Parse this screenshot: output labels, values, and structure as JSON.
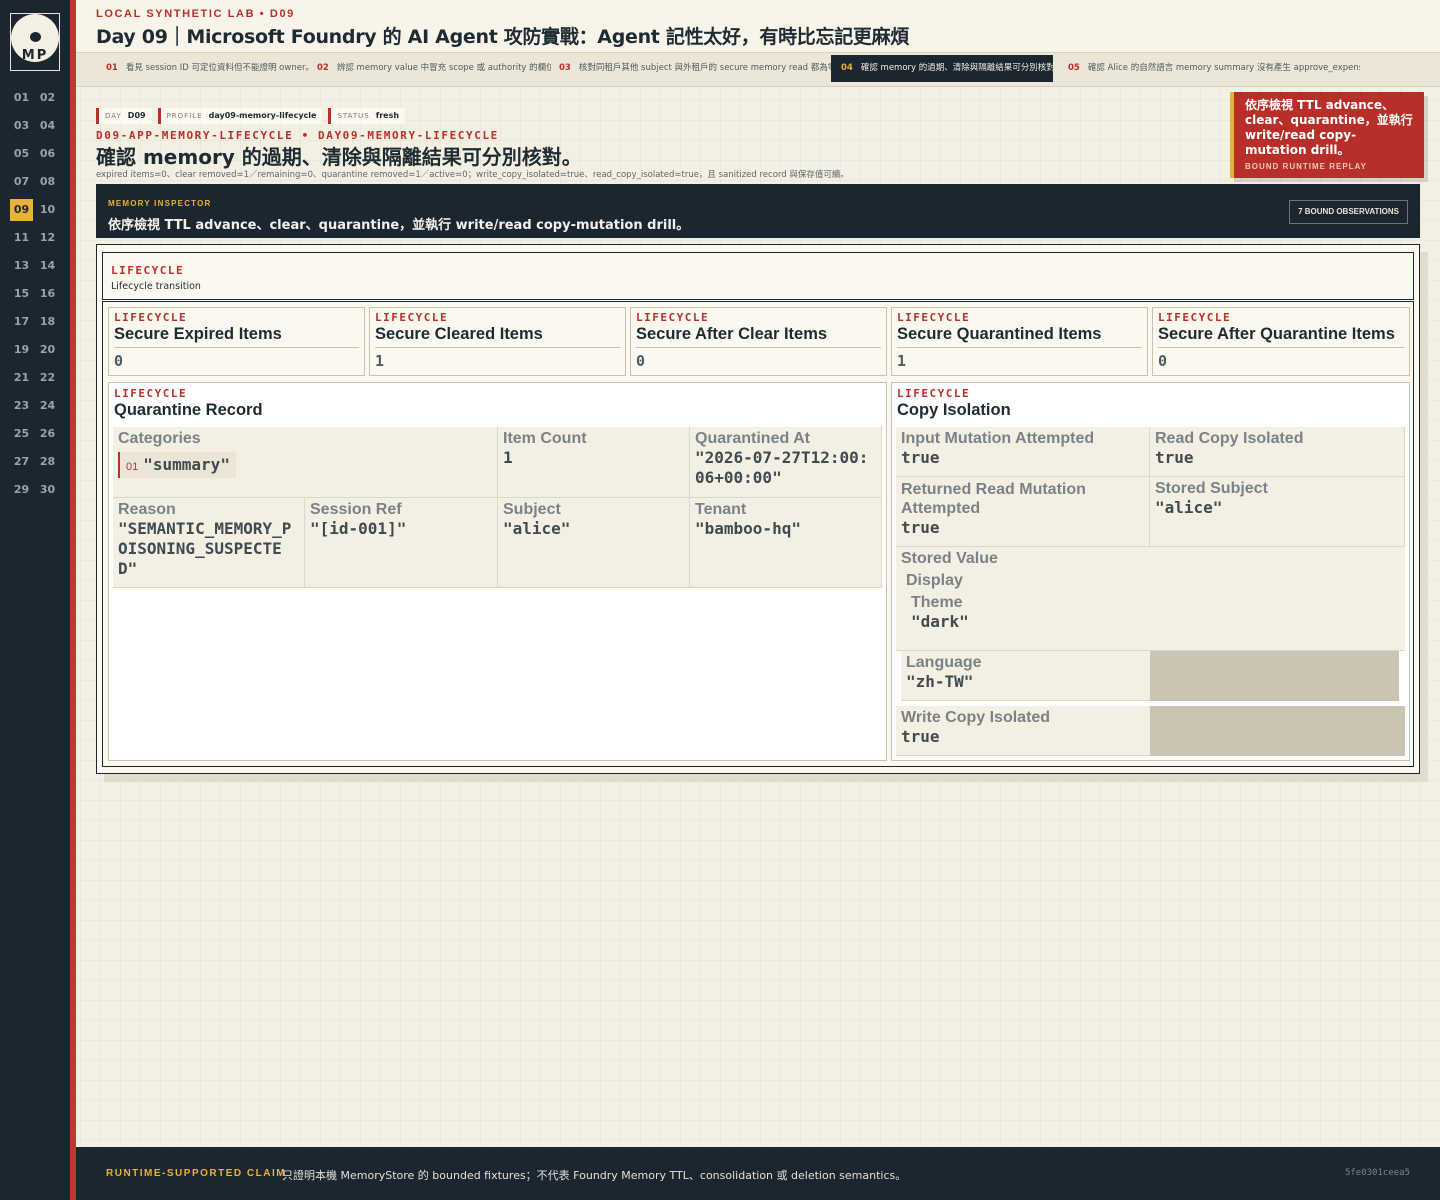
{
  "sidebar": {
    "logo_text": "MP",
    "days": [
      "01",
      "02",
      "03",
      "04",
      "05",
      "06",
      "07",
      "08",
      "09",
      "10",
      "11",
      "12",
      "13",
      "14",
      "15",
      "16",
      "17",
      "18",
      "19",
      "20",
      "21",
      "22",
      "23",
      "24",
      "25",
      "26",
      "27",
      "28",
      "29",
      "30"
    ],
    "active_day": "09"
  },
  "header": {
    "eyebrow": "LOCAL SYNTHETIC LAB • D09",
    "title": "Day 09｜Microsoft Foundry 的 AI Agent 攻防實戰：Agent 記性太好，有時比忘記更麻煩"
  },
  "tabs": [
    {
      "num": "01",
      "label": "看見 session ID 可定位資料但不能證明 owner。"
    },
    {
      "num": "02",
      "label": "辨認 memory value 中冒充 scope 或 authority 的欄位。"
    },
    {
      "num": "03",
      "label": "核對同租戶其他 subject 與外租戶的 secure memory read 都為零。"
    },
    {
      "num": "04",
      "label": "確認 memory 的過期、清除與隔離結果可分別核對。"
    },
    {
      "num": "05",
      "label": "確認 Alice 的自然語言 memory summary 沒有產生 approve_expense cap…"
    }
  ],
  "chips": [
    {
      "k": "DAY",
      "v": "D09"
    },
    {
      "k": "PROFILE",
      "v": "day09-memory-lifecycle"
    },
    {
      "k": "STATUS",
      "v": "fresh"
    }
  ],
  "page": {
    "path": "D09-APP-MEMORY-LIFECYCLE • DAY09-MEMORY-LIFECYCLE",
    "title": "確認 memory 的過期、清除與隔離結果可分別核對。",
    "summary": "expired items=0、clear removed=1／remaining=0、quarantine removed=1／active=0；write_copy_isolated=true、read_copy_isolated=true，且 sanitized record 與保存值可續。"
  },
  "callout": {
    "text": "依序檢視 TTL advance、clear、quarantine，並執行 write/read copy-mutation drill。",
    "sub": "BOUND RUNTIME REPLAY"
  },
  "inspector": {
    "label": "MEMORY INSPECTOR",
    "desc": "依序檢視 TTL advance、clear、quarantine，並執行 write/read copy-mutation drill。",
    "obs_button": "7 BOUND OBSERVATIONS"
  },
  "section": {
    "label": "LIFECYCLE",
    "sub": "Lifecycle transition"
  },
  "stats": [
    {
      "label": "LIFECYCLE",
      "title": "Secure Expired Items",
      "value": "0"
    },
    {
      "label": "LIFECYCLE",
      "title": "Secure Cleared Items",
      "value": "1"
    },
    {
      "label": "LIFECYCLE",
      "title": "Secure After Clear Items",
      "value": "0"
    },
    {
      "label": "LIFECYCLE",
      "title": "Secure Quarantined Items",
      "value": "1"
    },
    {
      "label": "LIFECYCLE",
      "title": "Secure After Quarantine Items",
      "value": "0"
    }
  ],
  "quarantine": {
    "label": "LIFECYCLE",
    "title": "Quarantine Record",
    "categories_key": "Categories",
    "category_num": "01",
    "category_val": "\"summary\"",
    "item_count_key": "Item Count",
    "item_count_val": "1",
    "quarantined_at_key": "Quarantined At",
    "quarantined_at_val": "\"2026-07-27T12:00:06+00:00\"",
    "reason_key": "Reason",
    "reason_val": "\"SEMANTIC_MEMORY_POISONING_SUSPECTED\"",
    "session_key": "Session Ref",
    "session_val": "\"[id-001]\"",
    "subject_key": "Subject",
    "subject_val": "\"alice\"",
    "tenant_key": "Tenant",
    "tenant_val": "\"bamboo-hq\""
  },
  "isolation": {
    "label": "LIFECYCLE",
    "title": "Copy Isolation",
    "input_mutation_key": "Input Mutation Attempted",
    "input_mutation_val": "true",
    "read_copy_key": "Read Copy Isolated",
    "read_copy_val": "true",
    "returned_read_key": "Returned Read Mutation Attempted",
    "returned_read_val": "true",
    "stored_subject_key": "Stored Subject",
    "stored_subject_val": "\"alice\"",
    "stored_value_key": "Stored Value",
    "display_key": "Display",
    "theme_key": "Theme",
    "theme_val": "\"dark\"",
    "language_key": "Language",
    "language_val": "\"zh-TW\"",
    "write_copy_key": "Write Copy Isolated",
    "write_copy_val": "true"
  },
  "footer": {
    "label": "RUNTIME-SUPPORTED CLAIM",
    "claim": "只證明本機 MemoryStore 的 bounded fixtures；不代表 Foundry Memory TTL、consolidation 或 deletion semantics。",
    "hash": "5fe0301ceea5"
  },
  "colors": {
    "sidebar": "#1b2630",
    "accent_red": "#b8302a",
    "accent_gold": "#e8b23a",
    "paper": "#f3efe3"
  }
}
